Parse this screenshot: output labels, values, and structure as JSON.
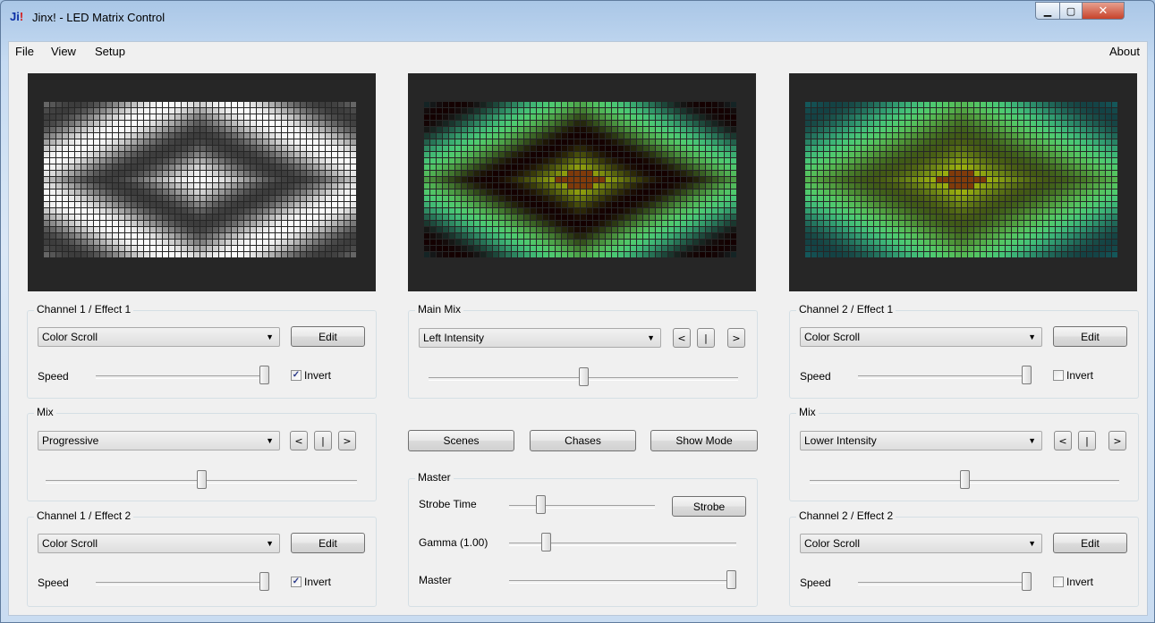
{
  "window": {
    "title": "Jinx! - LED Matrix Control",
    "icon_text": "Ji",
    "icon_bang": "!"
  },
  "menu": {
    "file": "File",
    "view": "View",
    "setup": "Setup",
    "about": "About"
  },
  "channel1_effect1": {
    "label": "Channel 1 / Effect 1",
    "effect": "Color Scroll",
    "edit": "Edit",
    "speed_label": "Speed",
    "speed": 1.0,
    "invert_label": "Invert",
    "invert": true
  },
  "mix_left": {
    "label": "Mix",
    "mode": "Progressive",
    "prev": "<",
    "mid": "|",
    "next": ">",
    "level": 0.5
  },
  "channel1_effect2": {
    "label": "Channel 1 / Effect 2",
    "effect": "Color Scroll",
    "edit": "Edit",
    "speed_label": "Speed",
    "speed": 1.0,
    "invert_label": "Invert",
    "invert": true
  },
  "main_mix": {
    "label": "Main Mix",
    "mode": "Left Intensity",
    "prev": "<",
    "mid": "|",
    "next": ">",
    "level": 0.5
  },
  "buttons": {
    "scenes": "Scenes",
    "chases": "Chases",
    "show_mode": "Show Mode"
  },
  "master": {
    "label": "Master",
    "strobe_time_label": "Strobe Time",
    "strobe_time": 0.2,
    "strobe": "Strobe",
    "gamma_label": "Gamma (1.00)",
    "gamma": 0.15,
    "master_label": "Master",
    "master": 1.0
  },
  "channel2_effect1": {
    "label": "Channel 2 / Effect 1",
    "effect": "Color Scroll",
    "edit": "Edit",
    "speed_label": "Speed",
    "speed": 1.0,
    "invert_label": "Invert",
    "invert": false
  },
  "mix_right": {
    "label": "Mix",
    "mode": "Lower Intensity",
    "prev": "<",
    "mid": "|",
    "next": ">",
    "level": 0.5
  },
  "channel2_effect2": {
    "label": "Channel 2 / Effect 2",
    "effect": "Color Scroll",
    "edit": "Edit",
    "speed_label": "Speed",
    "speed": 1.0,
    "invert_label": "Invert",
    "invert": false
  },
  "icons": {
    "combo_arrow": "▼",
    "check": "✓"
  }
}
